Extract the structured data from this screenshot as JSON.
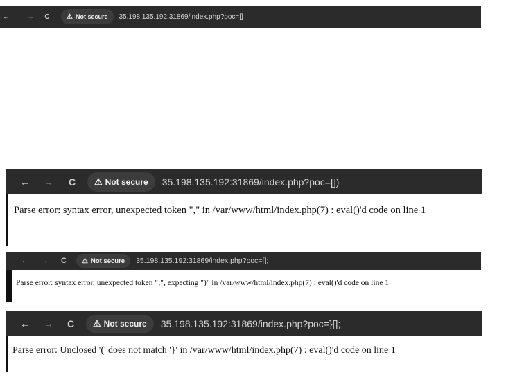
{
  "nav": {
    "back_glyph": "←",
    "forward_glyph": "→",
    "reload_glyph": "C",
    "warning_glyph": "⚠"
  },
  "screenshots": [
    {
      "security_label": "Not secure",
      "url": "35.198.135.192:31869/index.php?poc=[]",
      "message": ""
    },
    {
      "security_label": "Not secure",
      "url": "35.198.135.192:31869/index.php?poc=[])",
      "message": "Parse error: syntax error, unexpected token \",\" in /var/www/html/index.php(7) : eval()'d code on line 1"
    },
    {
      "security_label": "Not secure",
      "url": "35.198.135.192:31869/index.php?poc=[];",
      "message": "Parse error: syntax error, unexpected token \";\", expecting \")\" in /var/www/html/index.php(7) : eval()'d code on line 1"
    },
    {
      "security_label": "Not secure",
      "url": "35.198.135.192:31869/index.php?poc=}[];",
      "message": "Parse error: Unclosed '(' does not match '}' in /var/www/html/index.php(7) : eval()'d code on line 1"
    }
  ]
}
